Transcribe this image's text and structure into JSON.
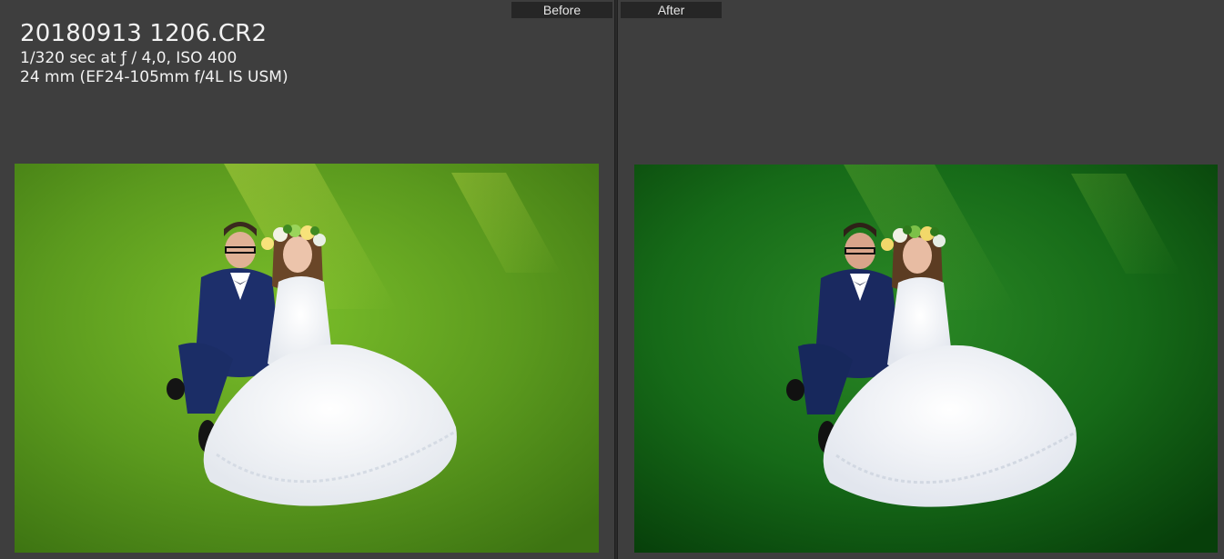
{
  "before_pane": {
    "label": "Before",
    "info": {
      "filename": "20180913 1206.CR2",
      "exposure": "1/320 sec at ƒ / 4,0, ISO 400",
      "lens": "24 mm (EF24-105mm f/4L IS USM)"
    }
  },
  "after_pane": {
    "label": "After"
  },
  "colors": {
    "background": "#3d3d3d",
    "label_bg": "#262626",
    "grass_before": "#5f9e1c",
    "grass_after": "#0f5a10"
  },
  "icons": {
    "before_photo": "wedding-couple-photo",
    "after_photo": "wedding-couple-photo-edited"
  }
}
